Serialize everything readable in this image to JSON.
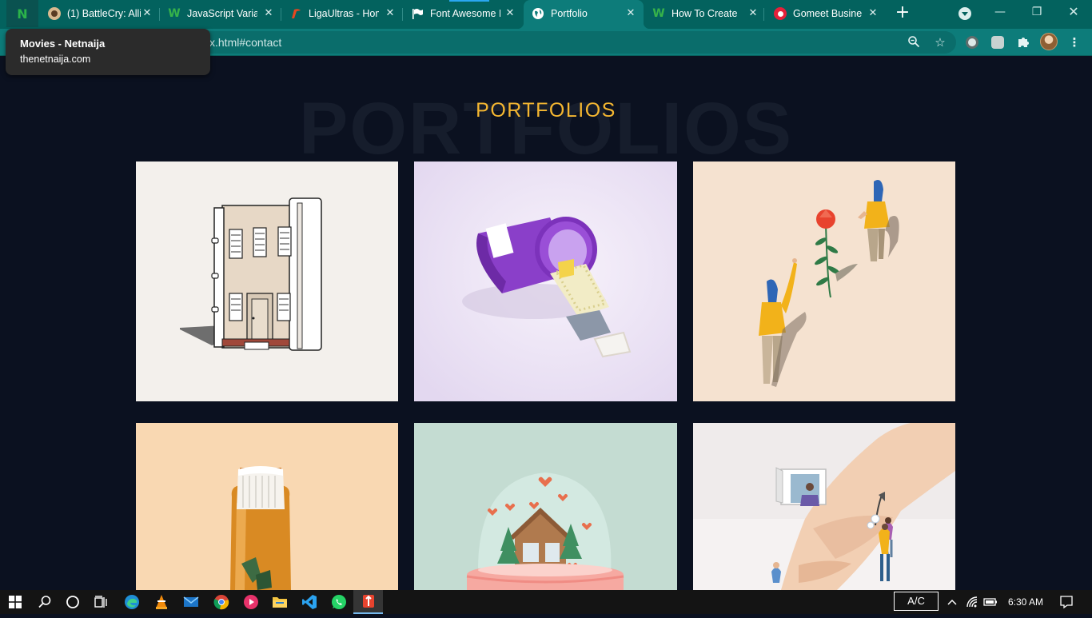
{
  "browser": {
    "tabs": [
      {
        "title": "",
        "favicon": "netnaija-n",
        "active": false
      },
      {
        "title": "(1) BattleCry: Alli",
        "favicon": "battlecry",
        "active": false
      },
      {
        "title": "JavaScript Variab",
        "favicon": "w3-w",
        "active": false
      },
      {
        "title": "LigaUltras - Hom",
        "favicon": "ligaultras",
        "active": false
      },
      {
        "title": "Font Awesome I",
        "favicon": "flag",
        "active": false
      },
      {
        "title": "Portfolio",
        "favicon": "globe",
        "active": true
      },
      {
        "title": "How To Create a",
        "favicon": "w3-w",
        "active": false
      },
      {
        "title": "Gomeet Busines",
        "favicon": "gomeet",
        "active": false
      }
    ],
    "url": "x.html#contact",
    "tooltip": {
      "title": "Movies - Netnaija",
      "url": "thenetnaija.com"
    },
    "colors": {
      "tabstrip": "#03625e",
      "toolbar": "#0d7c7a"
    }
  },
  "page": {
    "background_heading": "PORTFOLIOS",
    "heading": "PORTFOLIOS",
    "colors": {
      "background": "#0b1120",
      "heading_accent": "#f5b731"
    },
    "portfolio_items": [
      {
        "name": "building-book-illustration",
        "bg": "#f3f0ec"
      },
      {
        "name": "pill-bottle-illustration",
        "bg": "#ece6f5"
      },
      {
        "name": "figures-flower-illustration",
        "bg": "#f5e2d0"
      },
      {
        "name": "medicine-bottle-illustration",
        "bg": "#f8d6b0"
      },
      {
        "name": "snow-globe-illustration",
        "bg": "#c5ddd3"
      },
      {
        "name": "hand-window-illustration",
        "bg": "#eeeaea"
      }
    ]
  },
  "taskbar": {
    "apps": [
      "start",
      "search",
      "cortana",
      "task-view",
      "edge",
      "vlc",
      "mail",
      "chrome",
      "media-player",
      "file-explorer",
      "vscode",
      "whatsapp",
      "app-active"
    ],
    "ime": "A/C",
    "time": "6:30 AM"
  }
}
